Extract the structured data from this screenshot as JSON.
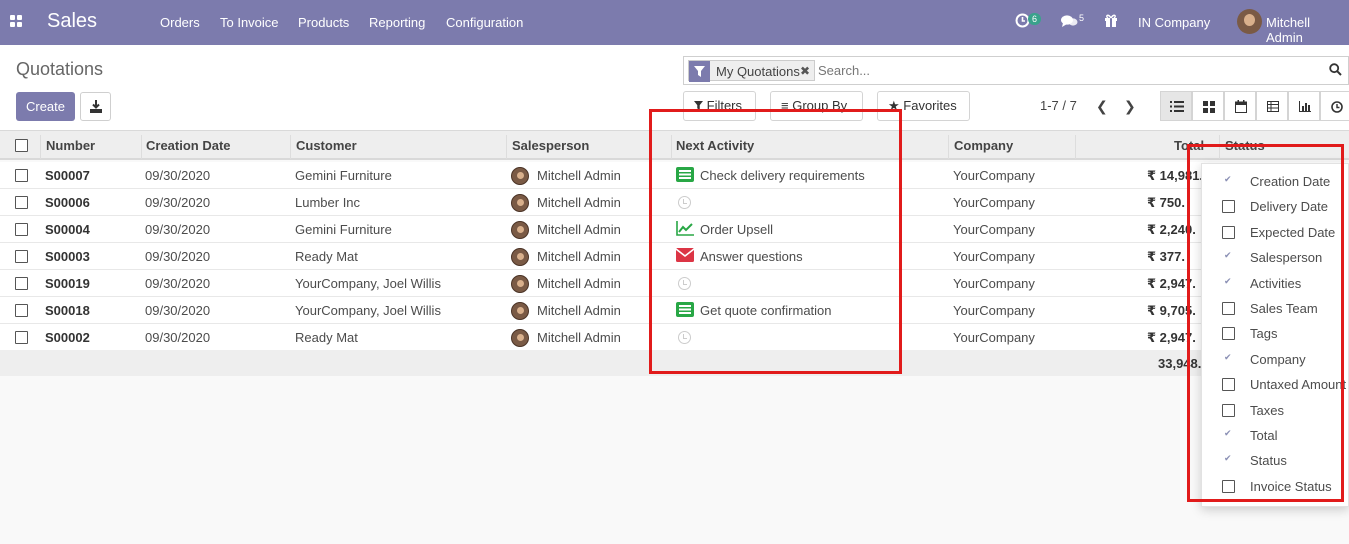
{
  "navbar": {
    "brand": "Sales",
    "menu": [
      "Orders",
      "To Invoice",
      "Products",
      "Reporting",
      "Configuration"
    ],
    "activity_count": "6",
    "message_count": "5",
    "company": "IN Company",
    "user": "Mitchell Admin"
  },
  "control_panel": {
    "title": "Quotations",
    "create_label": "Create",
    "facet_label": "My Quotations",
    "search_placeholder": "Search...",
    "filters_label": "Filters",
    "groupby_label": "Group By",
    "favorites_label": "Favorites",
    "pager": "1-7 / 7"
  },
  "table": {
    "headers": {
      "number": "Number",
      "creation_date": "Creation Date",
      "customer": "Customer",
      "salesperson": "Salesperson",
      "next_activity": "Next Activity",
      "company": "Company",
      "total": "Total",
      "status": "Status"
    },
    "rows": [
      {
        "number": "S00007",
        "date": "09/30/2020",
        "customer": "Gemini Furniture",
        "salesperson": "Mitchell Admin",
        "activity": "Check delivery requirements",
        "activity_icon": "tasks-icon",
        "company": "YourCompany",
        "total": "₹ 14,981."
      },
      {
        "number": "S00006",
        "date": "09/30/2020",
        "customer": "Lumber Inc",
        "salesperson": "Mitchell Admin",
        "activity": "",
        "activity_icon": "clock-icon",
        "company": "YourCompany",
        "total": "₹ 750."
      },
      {
        "number": "S00004",
        "date": "09/30/2020",
        "customer": "Gemini Furniture",
        "salesperson": "Mitchell Admin",
        "activity": "Order Upsell",
        "activity_icon": "line-chart-icon",
        "company": "YourCompany",
        "total": "₹ 2,240."
      },
      {
        "number": "S00003",
        "date": "09/30/2020",
        "customer": "Ready Mat",
        "salesperson": "Mitchell Admin",
        "activity": "Answer questions",
        "activity_icon": "envelope-icon",
        "company": "YourCompany",
        "total": "₹ 377."
      },
      {
        "number": "S00019",
        "date": "09/30/2020",
        "customer": "YourCompany, Joel Willis",
        "salesperson": "Mitchell Admin",
        "activity": "",
        "activity_icon": "clock-icon",
        "company": "YourCompany",
        "total": "₹ 2,947."
      },
      {
        "number": "S00018",
        "date": "09/30/2020",
        "customer": "YourCompany, Joel Willis",
        "salesperson": "Mitchell Admin",
        "activity": "Get quote confirmation",
        "activity_icon": "tasks-icon",
        "company": "YourCompany",
        "total": "₹ 9,705."
      },
      {
        "number": "S00002",
        "date": "09/30/2020",
        "customer": "Ready Mat",
        "salesperson": "Mitchell Admin",
        "activity": "",
        "activity_icon": "clock-icon",
        "company": "YourCompany",
        "total": "₹ 2,947."
      }
    ],
    "footer_total": "33,948."
  },
  "optional_columns": [
    {
      "label": "Creation Date",
      "checked": true
    },
    {
      "label": "Delivery Date",
      "checked": false
    },
    {
      "label": "Expected Date",
      "checked": false
    },
    {
      "label": "Salesperson",
      "checked": true
    },
    {
      "label": "Activities",
      "checked": true
    },
    {
      "label": "Sales Team",
      "checked": false
    },
    {
      "label": "Tags",
      "checked": false
    },
    {
      "label": "Company",
      "checked": true
    },
    {
      "label": "Untaxed Amount",
      "checked": false
    },
    {
      "label": "Taxes",
      "checked": false
    },
    {
      "label": "Total",
      "checked": true
    },
    {
      "label": "Status",
      "checked": true
    },
    {
      "label": "Invoice Status",
      "checked": false
    }
  ],
  "colors": {
    "brand": "#7c7bad",
    "annotation": "#e11b1b",
    "activity_green": "#28a745",
    "activity_red": "#dc3545"
  }
}
